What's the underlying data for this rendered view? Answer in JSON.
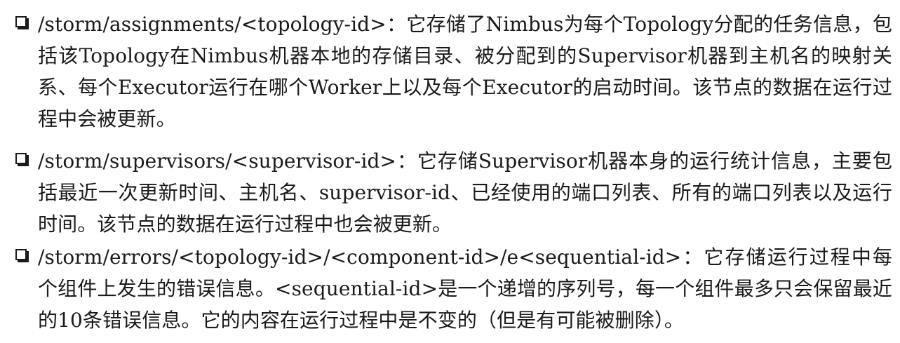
{
  "items": [
    {
      "text": "/storm/assignments/<topology-id>：它存储了Nimbus为每个Topology分配的任务信息，包括该Topology在Nimbus机器本地的存储目录、被分配到的Supervisor机器到主机名的映射关系、每个Executor运行在哪个Worker上以及每个Executor的启动时间。该节点的数据在运行过程中会被更新。"
    },
    {
      "text": "/storm/supervisors/<supervisor-id>：它存储Supervisor机器本身的运行统计信息，主要包括最近一次更新时间、主机名、supervisor-id、已经使用的端口列表、所有的端口列表以及运行时间。该节点的数据在运行过程中也会被更新。"
    },
    {
      "text": "/storm/errors/<topology-id>/<component-id>/e<sequential-id>：它存储运行过程中每个组件上发生的错误信息。<sequential-id>是一个递增的序列号，每一个组件最多只会保留最近的10条错误信息。它的内容在运行过程中是不变的（但是有可能被删除）。"
    }
  ]
}
